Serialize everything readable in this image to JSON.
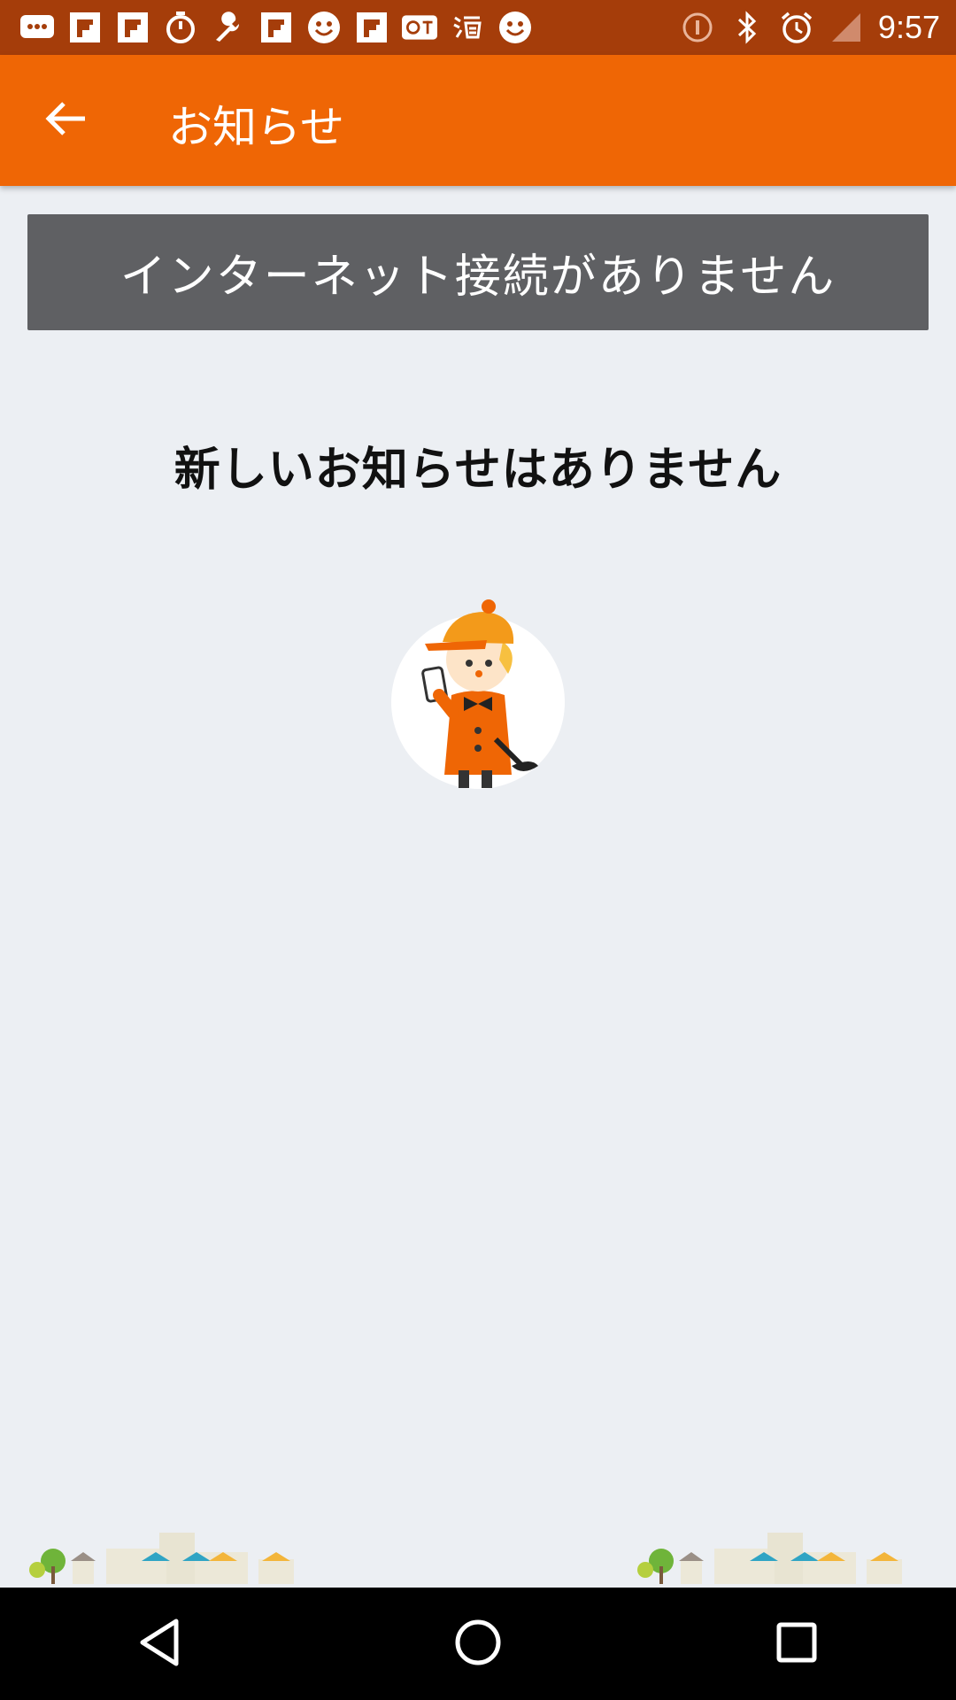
{
  "status_bar": {
    "time": "9:57",
    "left_icons": [
      "message-icon",
      "flipboard-icon",
      "flipboard-icon",
      "timer-icon",
      "wrench-icon",
      "flipboard-icon",
      "smiley-icon",
      "flipboard-icon",
      "qq-icon",
      "taobao-icon",
      "smiley-icon"
    ],
    "right_icons": [
      "info-circle-icon",
      "bluetooth-icon",
      "alarm-icon",
      "signal-off-icon"
    ]
  },
  "app_bar": {
    "title": "お知らせ",
    "back_icon": "arrow-back-icon"
  },
  "banner": {
    "text": "インターネット接続がありません"
  },
  "empty_state": {
    "message": "新しいお知らせはありません",
    "illustration": "detective-mascot"
  },
  "colors": {
    "app_bar": "#ef6605",
    "status_bar": "#a53d0a",
    "banner": "#5f6063",
    "background": "#eceff3"
  },
  "nav_bar": {
    "icons": [
      "back-triangle-icon",
      "home-circle-icon",
      "recents-square-icon"
    ]
  }
}
